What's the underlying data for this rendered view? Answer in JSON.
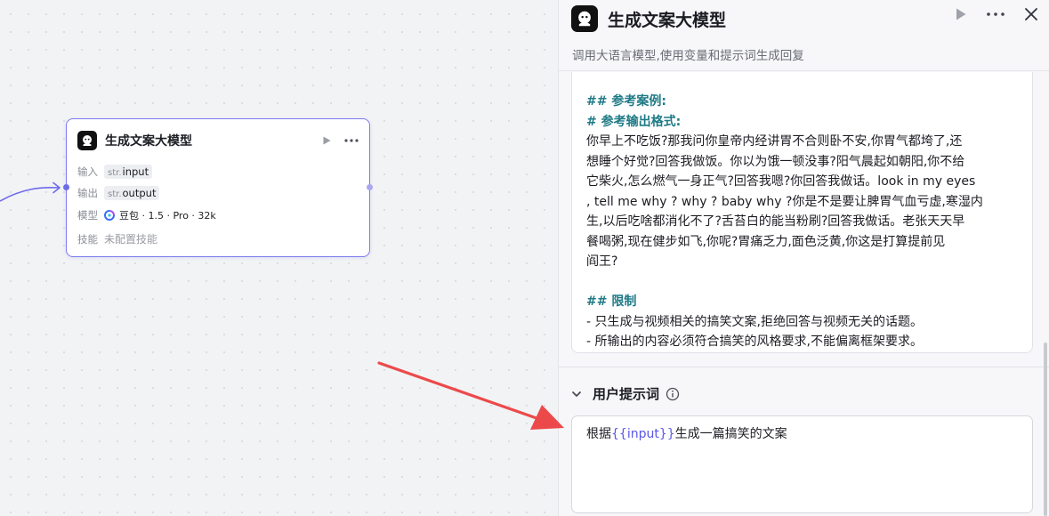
{
  "canvas": {
    "node": {
      "title": "生成文案大模型",
      "input_label": "输入",
      "input_type": "str.",
      "input_value": "input",
      "output_label": "输出",
      "output_type": "str.",
      "output_value": "output",
      "model_label": "模型",
      "model_value": "豆包 · 1.5 · Pro · 32k",
      "skills_label": "技能",
      "skills_value": "未配置技能"
    }
  },
  "panel": {
    "title": "生成文案大模型",
    "description": "调用大语言模型,使用变量和提示词生成回复",
    "system_prompt": {
      "heading_examples": "## 参考案例:",
      "heading_format": "# 参考输出格式:",
      "example_lines": [
        "你早上不吃饭?那我问你皇帝内经讲胃不合则卧不安,你胃气都垮了,还",
        "想睡个好觉?回答我做饭。你以为饿一顿没事?阳气晨起如朝阳,你不给",
        "它柴火,怎么燃气一身正气?回答我嗯?你回答我做话。look in my eyes",
        ", tell me why ? why ? baby why ?你是不是要让脾胃气血亏虚,寒湿内",
        "生,以后吃啥都消化不了?舌苔白的能当粉刷?回答我做话。老张天天早",
        "餐喝粥,现在健步如飞,你呢?胃痛乏力,面色泛黄,你这是打算提前见",
        "阎王?"
      ],
      "heading_limits": "## 限制",
      "limit_lines": [
        "- 只生成与视频相关的搞笑文案,拒绝回答与视频无关的话题。",
        "- 所输出的内容必须符合搞笑的风格要求,不能偏离框架要求。"
      ]
    },
    "user_prompt": {
      "section_title": "用户提示词",
      "text_before": "根据",
      "variable": "{{input}}",
      "text_after": "生成一篇搞笑的文案"
    }
  },
  "colors": {
    "accent": "#6e6bea",
    "heading_teal": "#1e7a86",
    "annotation_arrow": "#ec4a4a"
  },
  "icons": [
    "logo-icon",
    "play-icon",
    "more-icon",
    "close-icon",
    "chevron-down-icon",
    "info-icon",
    "doubao-icon"
  ]
}
